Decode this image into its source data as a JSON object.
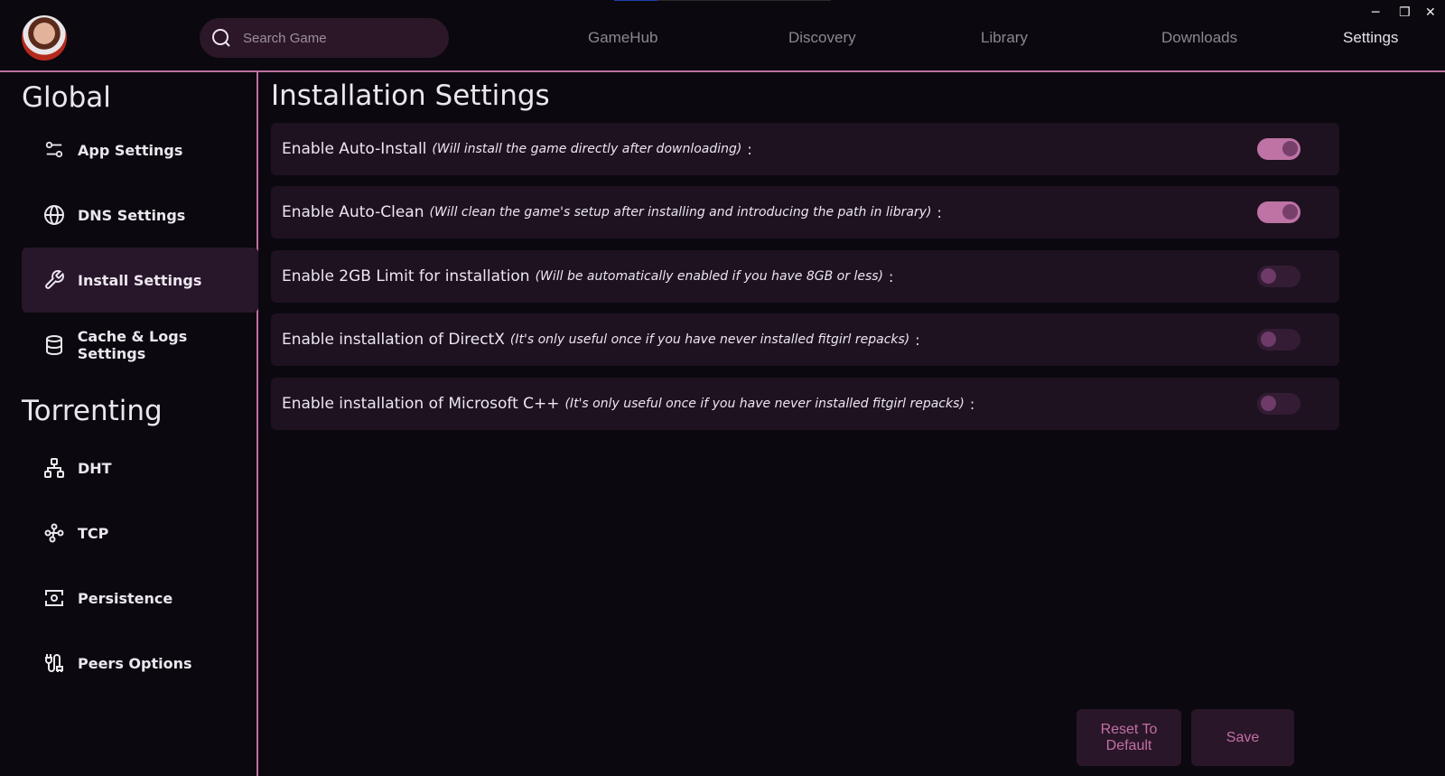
{
  "topbar": {
    "progress_percent": 20,
    "search": {
      "placeholder": "Search Game",
      "value": ""
    },
    "nav": [
      {
        "label": "GameHub",
        "active": false
      },
      {
        "label": "Discovery",
        "active": false
      },
      {
        "label": "Library",
        "active": false
      },
      {
        "label": "Downloads",
        "active": false
      },
      {
        "label": "Settings",
        "active": true
      }
    ],
    "window_controls": {
      "minimize": "─",
      "restore": "❐",
      "close": "✕"
    }
  },
  "sidebar": {
    "sections": [
      {
        "title": "Global",
        "items": [
          {
            "label": "App Settings",
            "icon": "sliders-icon",
            "active": false
          },
          {
            "label": "DNS Settings",
            "icon": "globe-icon",
            "active": false
          },
          {
            "label": "Install Settings",
            "icon": "wrench-icon",
            "active": true
          },
          {
            "label": "Cache & Logs Settings",
            "icon": "database-icon",
            "active": false
          }
        ]
      },
      {
        "title": "Torrenting",
        "items": [
          {
            "label": "DHT",
            "icon": "network-icon",
            "active": false
          },
          {
            "label": "TCP",
            "icon": "route-icon",
            "active": false
          },
          {
            "label": "Persistence",
            "icon": "settings-frame-icon",
            "active": false
          },
          {
            "label": "Peers Options",
            "icon": "cable-icon",
            "active": false
          }
        ]
      }
    ]
  },
  "main": {
    "title": "Installation Settings",
    "settings": [
      {
        "label": "Enable Auto-Install",
        "hint": "(Will install the game directly after downloading)",
        "suffix": ":",
        "enabled": true
      },
      {
        "label": "Enable Auto-Clean",
        "hint": "(Will clean the game's setup after installing and introducing the path in library)",
        "suffix": ":",
        "enabled": true
      },
      {
        "label": "Enable 2GB Limit for installation",
        "hint": "(Will be automatically enabled if you have 8GB or less)",
        "suffix": ":",
        "enabled": false
      },
      {
        "label": "Enable installation of DirectX",
        "hint": "(It's only useful once if you have never installed fitgirl repacks)",
        "suffix": ":",
        "enabled": false
      },
      {
        "label": "Enable installation of Microsoft C++",
        "hint": "(It's only useful once if you have never installed fitgirl repacks)",
        "suffix": ":",
        "enabled": false
      }
    ],
    "buttons": {
      "reset": "Reset To Default",
      "save": "Save"
    }
  },
  "colors": {
    "accent": "#c06fa0",
    "background": "#0b080f",
    "card": "#1e1220",
    "toggle_on": "#be73a4",
    "toggle_off": "#331c34"
  }
}
